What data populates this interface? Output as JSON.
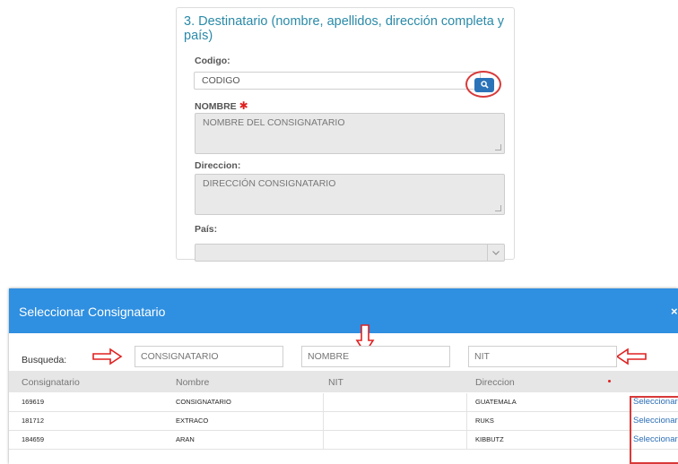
{
  "form": {
    "section_title": "3. Destinatario (nombre, apellidos, dirección completa y país)",
    "codigo_label": "Codigo:",
    "codigo_value": "CODIGO",
    "nombre_label": "NOMBRE",
    "nombre_value": "NOMBRE DEL CONSIGNATARIO",
    "direccion_label": "Direccion:",
    "direccion_value": "DIRECCIÓN CONSIGNATARIO",
    "pais_label": "País:",
    "pais_value": "",
    "required_mark": "✱"
  },
  "modal": {
    "title": "Seleccionar Consignatario",
    "close": "×",
    "search_label": "Busqueda:",
    "filters": {
      "consignatario_placeholder": "CONSIGNATARIO",
      "nombre_placeholder": "NOMBRE",
      "nit_placeholder": "NIT"
    },
    "columns": [
      "Consignatario",
      "Nombre",
      "NIT",
      "Direccion"
    ],
    "rows": [
      {
        "consignatario": "169619",
        "nombre": "CONSIGNATARIO",
        "nit": "",
        "direccion": "GUATEMALA",
        "action": "Seleccionar"
      },
      {
        "consignatario": "181712",
        "nombre": "EXTRACO",
        "nit": "",
        "direccion": "RUKS",
        "action": "Seleccionar"
      },
      {
        "consignatario": "184659",
        "nombre": "ARAN",
        "nit": "",
        "direccion": "KIBBUTZ",
        "action": "Seleccionar"
      }
    ]
  },
  "colors": {
    "accent": "#2f8fe0",
    "title": "#2a8aa8",
    "button": "#2b73b8",
    "annotation": "#d83a3a",
    "link": "#2a6db5"
  },
  "icons": {
    "search_button": "search-icon",
    "select_arrow": "chevron-down-icon",
    "annotation_arrows": [
      "arrow-right-icon",
      "arrow-down-icon",
      "arrow-left-icon"
    ]
  }
}
